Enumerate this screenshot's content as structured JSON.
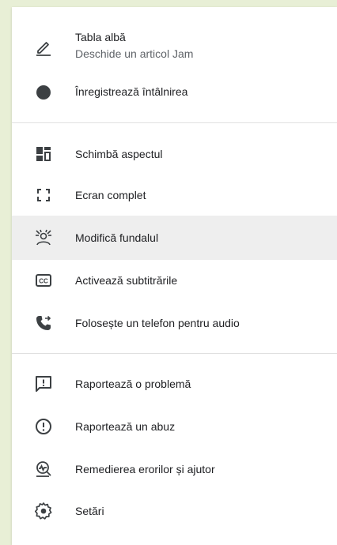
{
  "menu": {
    "whiteboard": {
      "label": "Tabla albă",
      "sublabel": "Deschide un articol Jam",
      "icon": "pencil-icon"
    },
    "record": {
      "label": "Înregistrează întâlnirea",
      "icon": "record-dot-icon"
    },
    "layout": {
      "label": "Schimbă aspectul",
      "icon": "layout-icon"
    },
    "fullscreen": {
      "label": "Ecran complet",
      "icon": "fullscreen-icon"
    },
    "background": {
      "label": "Modifică fundalul",
      "icon": "background-blur-icon"
    },
    "captions": {
      "label": "Activează subtitrările",
      "icon": "closed-captions-icon"
    },
    "phone_audio": {
      "label": "Folosește un telefon pentru audio",
      "icon": "phone-forward-icon"
    },
    "report_problem": {
      "label": "Raportează o problemă",
      "icon": "feedback-icon"
    },
    "report_abuse": {
      "label": "Raportează un abuz",
      "icon": "exclamation-circle-icon"
    },
    "troubleshoot": {
      "label": "Remedierea erorilor și ajutor",
      "icon": "troubleshoot-icon"
    },
    "settings": {
      "label": "Setări",
      "icon": "gear-icon"
    }
  },
  "colors": {
    "text": "#202124",
    "subtext": "#5f6368",
    "icon": "#3c4043",
    "hover_bg": "#eeeeee",
    "divider": "#e0e0e0",
    "page_bg": "#e8efd6"
  }
}
